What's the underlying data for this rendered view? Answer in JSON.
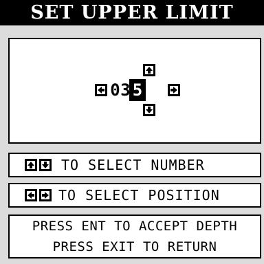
{
  "title": "SET UPPER LIMIT",
  "editor": {
    "digits": [
      "0",
      "3",
      "5"
    ],
    "selected_index": 2
  },
  "hints": {
    "select_number": "TO SELECT NUMBER",
    "select_position": "TO SELECT POSITION"
  },
  "messages": {
    "accept": "PRESS ENT TO ACCEPT DEPTH",
    "return": "PRESS EXIT TO RETURN"
  },
  "icons": {
    "up": "arrow-up-icon",
    "down": "arrow-down-icon",
    "left": "arrow-left-icon",
    "right": "arrow-right-icon"
  },
  "colors": {
    "background": "#ffffff",
    "panel": "#dcdcdc",
    "ink": "#000000"
  }
}
